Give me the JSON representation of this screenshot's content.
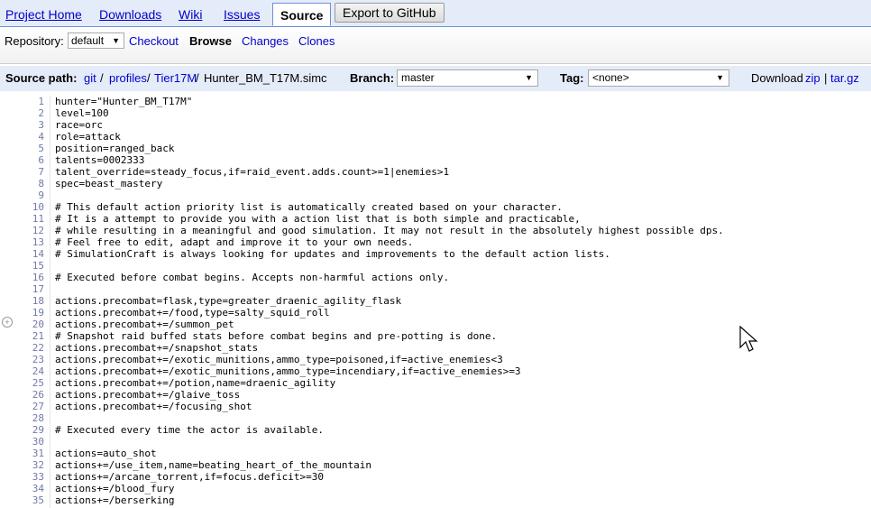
{
  "tabs": [
    {
      "label": "Project Home"
    },
    {
      "label": "Downloads"
    },
    {
      "label": "Wiki"
    },
    {
      "label": "Issues"
    },
    {
      "label": "Source"
    }
  ],
  "export_button": "Export to GitHub",
  "subnav": {
    "repository_label": "Repository:",
    "repository_value": "default",
    "links": [
      "Checkout",
      "Browse",
      "Changes",
      "Clones"
    ]
  },
  "path": {
    "label": "Source path:",
    "segments": [
      "git",
      "profiles",
      "Tier17M"
    ],
    "separator": "/",
    "file": "Hunter_BM_T17M.simc",
    "branch_label": "Branch:",
    "branch_value": "master",
    "tag_label": "Tag:",
    "tag_value": "<none>",
    "download_label": "Download",
    "download_zip": "zip",
    "download_sep": "|",
    "download_targz": "tar.gz"
  },
  "code_lines": [
    "hunter=\"Hunter_BM_T17M\"",
    "level=100",
    "race=orc",
    "role=attack",
    "position=ranged_back",
    "talents=0002333",
    "talent_override=steady_focus,if=raid_event.adds.count>=1|enemies>1",
    "spec=beast_mastery",
    "",
    "# This default action priority list is automatically created based on your character.",
    "# It is a attempt to provide you with a action list that is both simple and practicable,",
    "# while resulting in a meaningful and good simulation. It may not result in the absolutely highest possible dps.",
    "# Feel free to edit, adapt and improve it to your own needs.",
    "# SimulationCraft is always looking for updates and improvements to the default action lists.",
    "",
    "# Executed before combat begins. Accepts non-harmful actions only.",
    "",
    "actions.precombat=flask,type=greater_draenic_agility_flask",
    "actions.precombat+=/food,type=salty_squid_roll",
    "actions.precombat+=/summon_pet",
    "# Snapshot raid buffed stats before combat begins and pre-potting is done.",
    "actions.precombat+=/snapshot_stats",
    "actions.precombat+=/exotic_munitions,ammo_type=poisoned,if=active_enemies<3",
    "actions.precombat+=/exotic_munitions,ammo_type=incendiary,if=active_enemies>=3",
    "actions.precombat+=/potion,name=draenic_agility",
    "actions.precombat+=/glaive_toss",
    "actions.precombat+=/focusing_shot",
    "",
    "# Executed every time the actor is available.",
    "",
    "actions=auto_shot",
    "actions+=/use_item,name=beating_heart_of_the_mountain",
    "actions+=/arcane_torrent,if=focus.deficit>=30",
    "actions+=/blood_fury",
    "actions+=/berserking"
  ],
  "icons": {
    "dropdown_arrow": "▼",
    "line_zoom": "+"
  }
}
